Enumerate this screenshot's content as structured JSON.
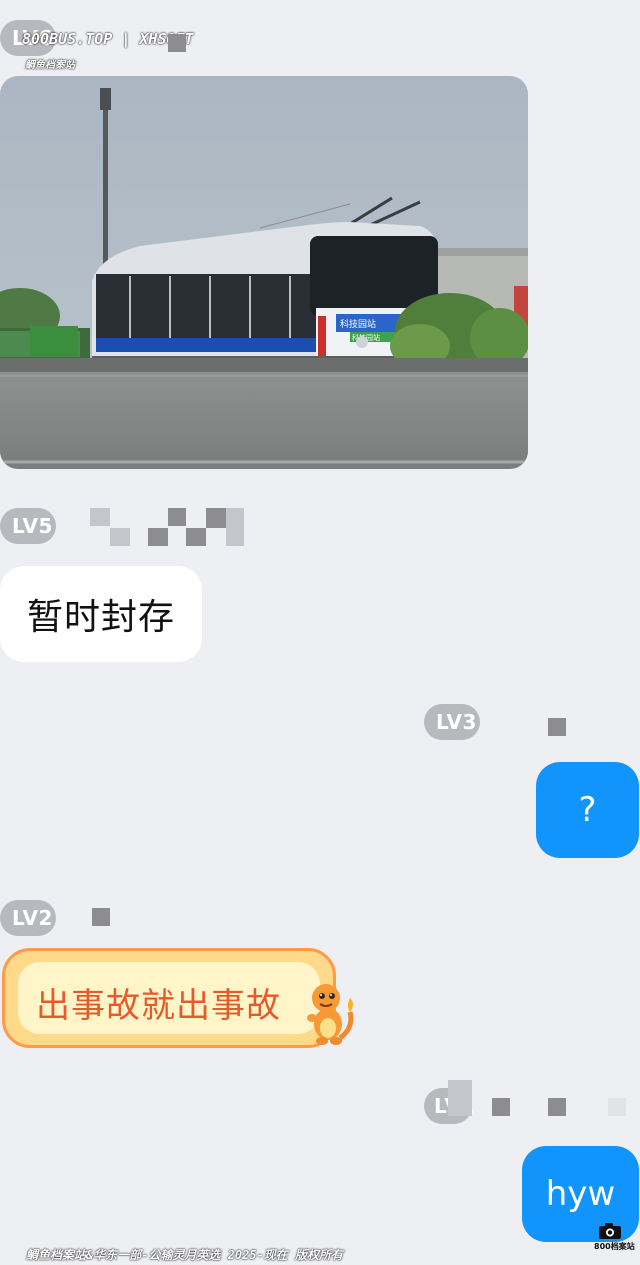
{
  "watermark": {
    "top": "800BUS.TOP | XHSOFT",
    "top_sub": "鲷鱼档案站",
    "bottom": "鲷鱼档案站&华东一部-公输灵月英选 2025-现在 版权所有",
    "logo_text": "800档案站"
  },
  "messages": [
    {
      "side": "in",
      "level": "LV6",
      "type": "image"
    },
    {
      "side": "in",
      "level": "LV5",
      "type": "text",
      "text": "暂时封存"
    },
    {
      "side": "out",
      "level": "LV3",
      "type": "text",
      "text": "?"
    },
    {
      "side": "in",
      "level": "LV2",
      "type": "sticker-text",
      "text": "出事故就出事故"
    },
    {
      "side": "out",
      "level": "LV1",
      "type": "text",
      "text": "hyw"
    }
  ],
  "photo": {
    "bus_sign_line1": "科技园站",
    "bus_sign_line2": "科技园站"
  },
  "colors": {
    "background": "#eeeff3",
    "bubble_in": "#ffffff",
    "bubble_out": "#1195fd",
    "level_badge": "#b8b9be",
    "sticker_text": "#e55a2a"
  }
}
